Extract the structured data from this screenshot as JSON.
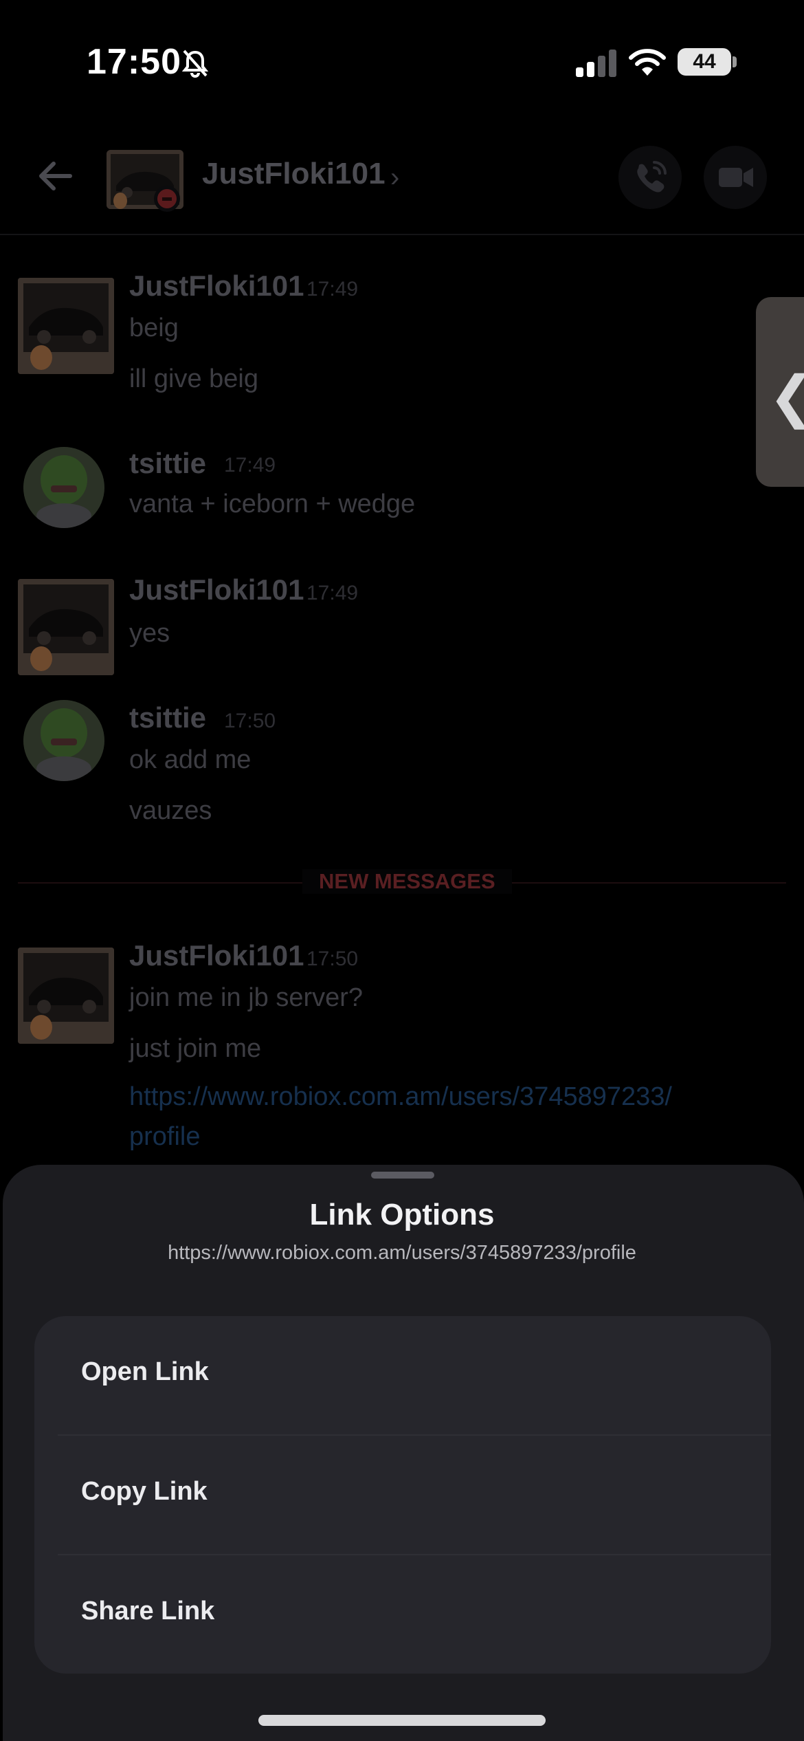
{
  "status_bar": {
    "time": "17:50",
    "battery": "44"
  },
  "header": {
    "title": "JustFloki101",
    "chevron": "›",
    "icons": [
      "back-arrow-icon",
      "phone-call-icon",
      "video-call-icon"
    ]
  },
  "messages": [
    {
      "author": "JustFloki101",
      "time": "17:49",
      "lines": [
        "beig",
        "ill give beig"
      ]
    },
    {
      "author": "tsittie",
      "time": "17:49",
      "lines": [
        "vanta + iceborn + wedge"
      ]
    },
    {
      "author": "JustFloki101",
      "time": "17:49",
      "lines": [
        "yes"
      ]
    },
    {
      "author": "tsittie",
      "time": "17:50",
      "lines": [
        "ok add me",
        "vauzes"
      ]
    },
    {
      "author": "JustFloki101",
      "time": "17:50",
      "lines": [
        "join me in jb server?",
        "just join me"
      ],
      "link_lines": [
        "https://www.robiox.com.am/users/3745897233/",
        "profile"
      ]
    }
  ],
  "new_messages_label": "NEW MESSAGES",
  "side_handle": "❮",
  "sheet": {
    "title": "Link Options",
    "url": "https://www.robiox.com.am/users/3745897233/profile",
    "options": [
      "Open Link",
      "Copy Link",
      "Share Link"
    ]
  },
  "colors": {
    "background": "#000000",
    "sheet": "#1c1c20",
    "options_group": "#26262c",
    "new_messages": "#5a1f22",
    "link": "#16304e"
  }
}
